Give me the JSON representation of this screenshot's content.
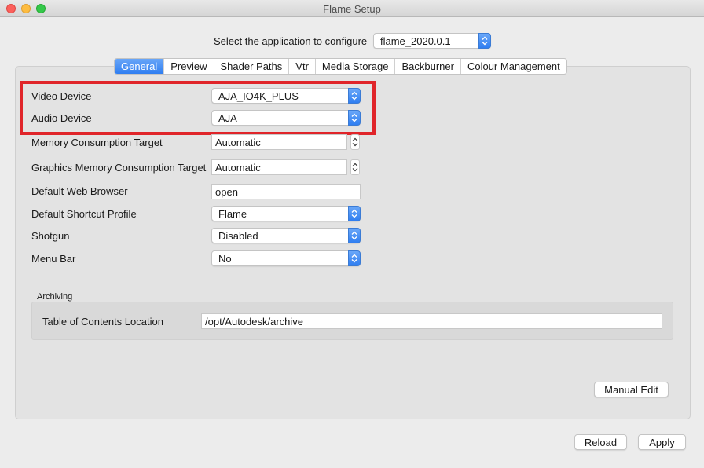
{
  "window": {
    "title": "Flame Setup"
  },
  "app_select": {
    "label": "Select the application to configure",
    "value": "flame_2020.0.1"
  },
  "tabs": [
    {
      "label": "General",
      "active": true
    },
    {
      "label": "Preview",
      "active": false
    },
    {
      "label": "Shader Paths",
      "active": false
    },
    {
      "label": "Vtr",
      "active": false
    },
    {
      "label": "Media Storage",
      "active": false
    },
    {
      "label": "Backburner",
      "active": false
    },
    {
      "label": "Colour Management",
      "active": false
    }
  ],
  "general": {
    "video_device": {
      "label": "Video Device",
      "value": "AJA_IO4K_PLUS"
    },
    "audio_device": {
      "label": "Audio Device",
      "value": "AJA"
    },
    "memory_target": {
      "label": "Memory Consumption Target",
      "value": "Automatic"
    },
    "graphics_memory_target": {
      "label": "Graphics Memory Consumption Target",
      "value": "Automatic"
    },
    "web_browser": {
      "label": "Default Web Browser",
      "value": "open"
    },
    "shortcut_profile": {
      "label": "Default Shortcut Profile",
      "value": "Flame"
    },
    "shotgun": {
      "label": "Shotgun",
      "value": "Disabled"
    },
    "menu_bar": {
      "label": "Menu Bar",
      "value": "No"
    }
  },
  "archiving": {
    "group_label": "Archiving",
    "toc_label": "Table of Contents Location",
    "toc_value": "/opt/Autodesk/archive"
  },
  "buttons": {
    "manual_edit": "Manual Edit",
    "reload": "Reload",
    "apply": "Apply"
  },
  "colors": {
    "accent": "#2f7ef1",
    "highlight_box": "#e0252a"
  }
}
